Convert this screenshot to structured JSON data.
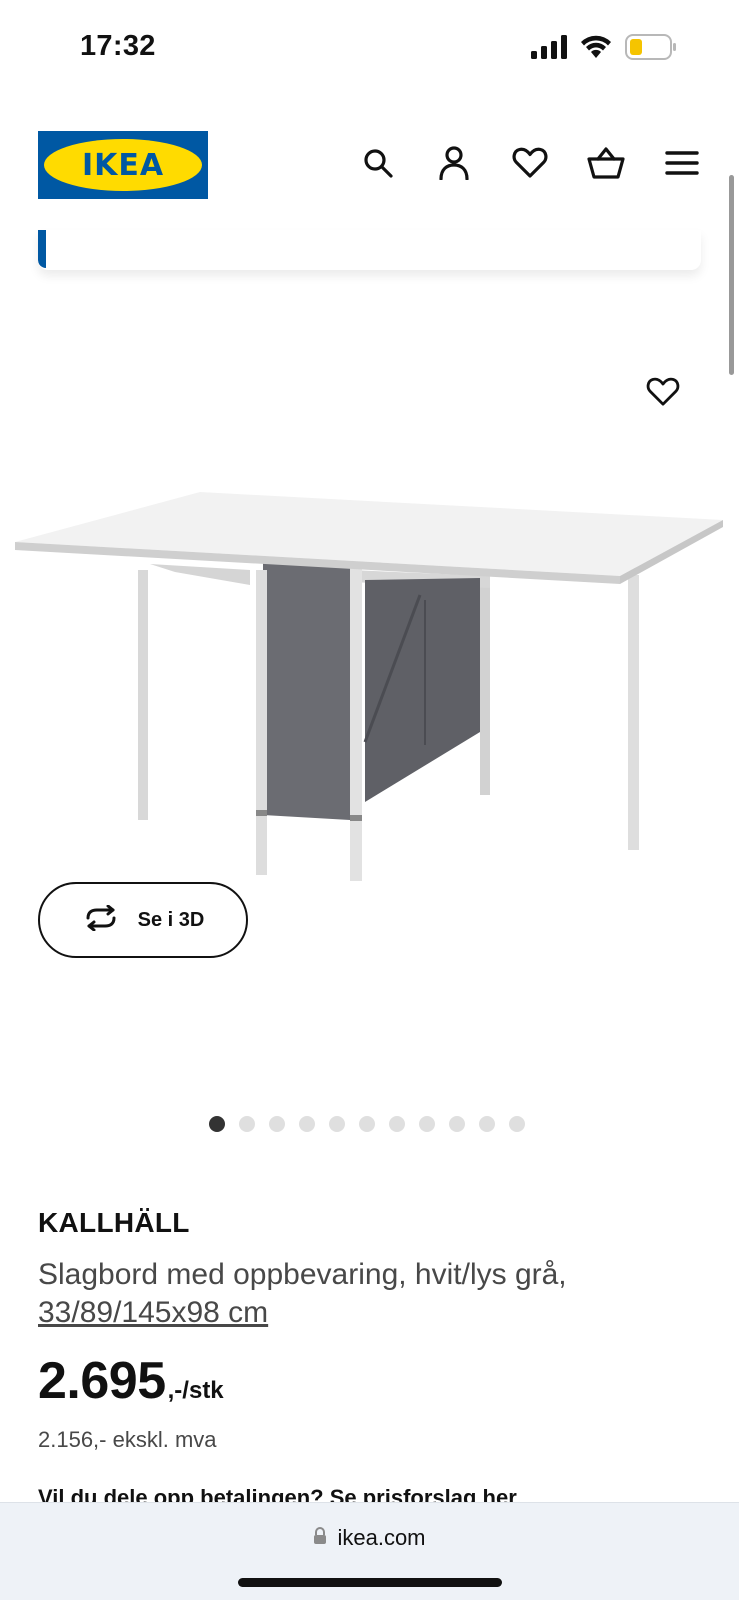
{
  "status_bar": {
    "time": "17:32",
    "icons": [
      "cellular-signal-icon",
      "wifi-icon",
      "battery-low-icon"
    ],
    "battery_color": "#f5c400"
  },
  "header": {
    "logo_text": "IKEA",
    "brand_blue": "#0058a3",
    "brand_yellow": "#ffdb00",
    "icons": [
      "search-icon",
      "account-icon",
      "favourites-icon",
      "shopping-basket-icon",
      "menu-icon"
    ]
  },
  "product": {
    "image_alt_icons": [
      "favourite-heart-icon"
    ],
    "view_3d_label": "Se i 3D",
    "carousel": {
      "total": 11,
      "active_index": 0
    },
    "name": "KALLHÄLL",
    "description": "Slagbord med oppbevaring, hvit/lys grå,",
    "dimensions": "33/89/145x98 cm",
    "price_main": "2.695",
    "price_suffix": ",-/stk",
    "price_ex_vat": "2.156,- ekskl. mva",
    "installment_text": "Vil du dele opp betalingen? Se prisforslag her"
  },
  "browser": {
    "url": "ikea.com"
  }
}
